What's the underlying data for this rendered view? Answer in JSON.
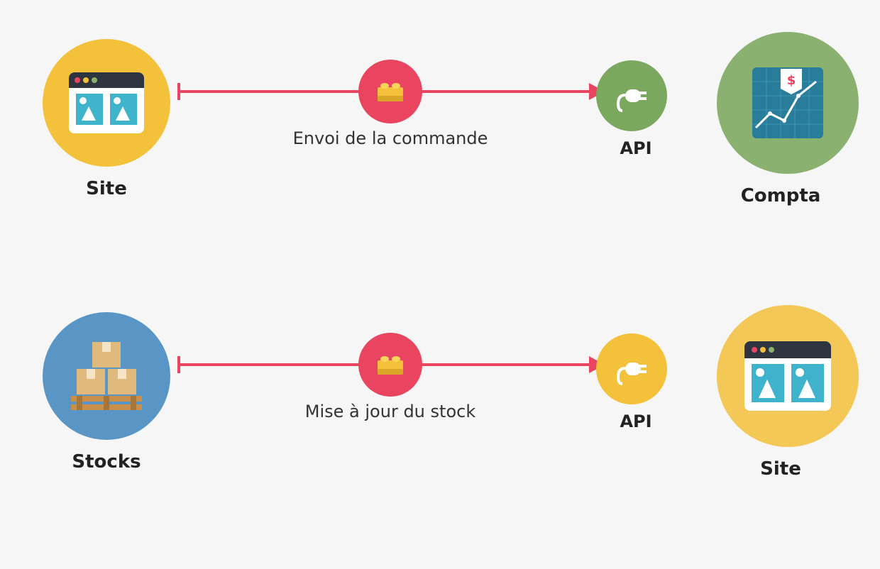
{
  "flows": [
    {
      "left_label": "Site",
      "action_label": "Envoi de la commande",
      "api_label": "API",
      "right_label": "Compta"
    },
    {
      "left_label": "Stocks",
      "action_label": "Mise à jour du stock",
      "api_label": "API",
      "right_label": "Site"
    }
  ]
}
